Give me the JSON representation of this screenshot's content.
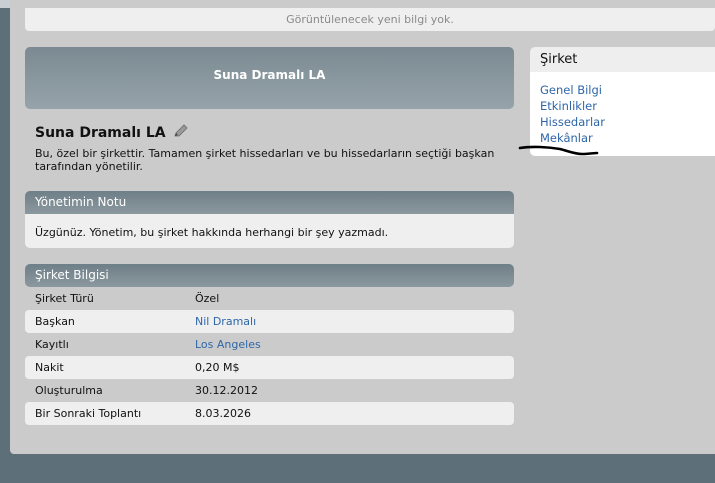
{
  "notice": {
    "text": "Görüntülenecek yeni bilgi yok."
  },
  "banner": {
    "name": "Suna Dramalı LA"
  },
  "company": {
    "title": "Suna Dramalı LA",
    "description": "Bu, özel bir şirkettir. Tamamen şirket hissedarları ve bu hissedarların seçtiği başkan tarafından yönetilir."
  },
  "management_note": {
    "header": "Yönetimin Notu",
    "text": "Üzgünüz. Yönetim, bu şirket hakkında herhangi bir şey yazmadı."
  },
  "company_info": {
    "header": "Şirket Bilgisi",
    "rows": [
      {
        "label": "Şirket Türü",
        "value": "Özel",
        "is_link": false
      },
      {
        "label": "Başkan",
        "value": "Nil Dramalı",
        "is_link": true
      },
      {
        "label": "Kayıtlı",
        "value": "Los Angeles",
        "is_link": true
      },
      {
        "label": "Nakit",
        "value": "0,20 M$",
        "is_link": false
      },
      {
        "label": "Oluşturulma",
        "value": "30.12.2012",
        "is_link": false
      },
      {
        "label": "Bir Sonraki Toplantı",
        "value": "8.03.2026",
        "is_link": false
      }
    ]
  },
  "sidebar": {
    "header": "Şirket",
    "items": [
      {
        "label": "Genel Bilgi"
      },
      {
        "label": "Etkinlikler"
      },
      {
        "label": "Hissedarlar"
      },
      {
        "label": "Mekânlar"
      }
    ]
  },
  "icons": {
    "edit": "pencil-icon"
  },
  "colors": {
    "background": "#5d7079",
    "panel": "#cbcbcb",
    "link": "#2e67a8",
    "header_gradient_top": "#6f7f87",
    "header_gradient_bottom": "#8b989f"
  }
}
